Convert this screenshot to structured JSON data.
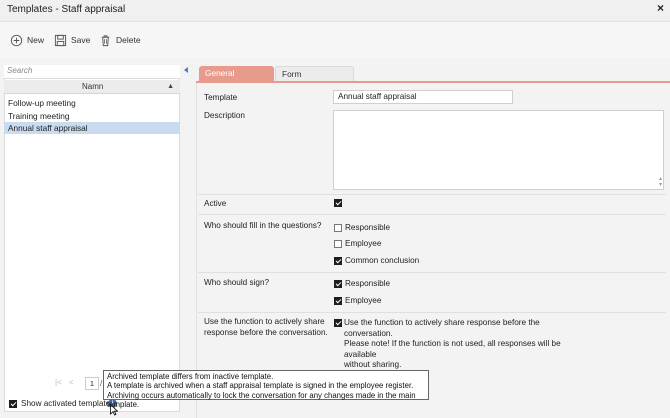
{
  "window": {
    "title": "Templates - Staff appraisal",
    "close_glyph": "×"
  },
  "toolbar": {
    "new_label": "New",
    "save_label": "Save",
    "delete_label": "Delete"
  },
  "left": {
    "search_placeholder": "Search",
    "column_header": "Namn",
    "items": [
      {
        "label": "Follow-up meeting"
      },
      {
        "label": "Training meeting"
      },
      {
        "label": "Annual staff appraisal",
        "selected": true
      }
    ],
    "pager": {
      "first": "|<",
      "prev": "<",
      "page": "1",
      "separator": "/"
    },
    "show_activated_label": "Show activated templates",
    "show_activated_checked": true
  },
  "tabs": [
    {
      "label": "General",
      "active": true
    },
    {
      "label": "Form"
    }
  ],
  "form": {
    "template_label": "Template",
    "template_value": "Annual staff appraisal",
    "description_label": "Description",
    "active_label": "Active",
    "active_checked": true,
    "who_fill_label": "Who should fill in the questions?",
    "fill_options": [
      {
        "label": "Responsible",
        "checked": false
      },
      {
        "label": "Employee",
        "checked": false
      },
      {
        "label": "Common conclusion",
        "checked": true
      }
    ],
    "who_sign_label": "Who should sign?",
    "sign_options": [
      {
        "label": "Responsible",
        "checked": true
      },
      {
        "label": "Employee",
        "checked": true
      }
    ],
    "share_label_line1": "Use the function to actively share",
    "share_label_line2": "response before the conversation.",
    "share_checked": true,
    "share_note_line1": "Use the function to actively share response before the conversation.",
    "share_note_line2": "Please note! If the function is not used, all responses will be available",
    "share_note_line3": "without sharing."
  },
  "tooltip": {
    "line1": "Archived template differs from inactive template.",
    "line2": "A template is archived when a staff appraisal template is signed in the employee register.",
    "line3": "Archiving occurs automatically to lock the conversation for any changes made in the main template."
  },
  "colors": {
    "accent_tab": "#e89a8c",
    "selected_row": "#c9dcef",
    "info_icon": "#3c6ea8"
  }
}
